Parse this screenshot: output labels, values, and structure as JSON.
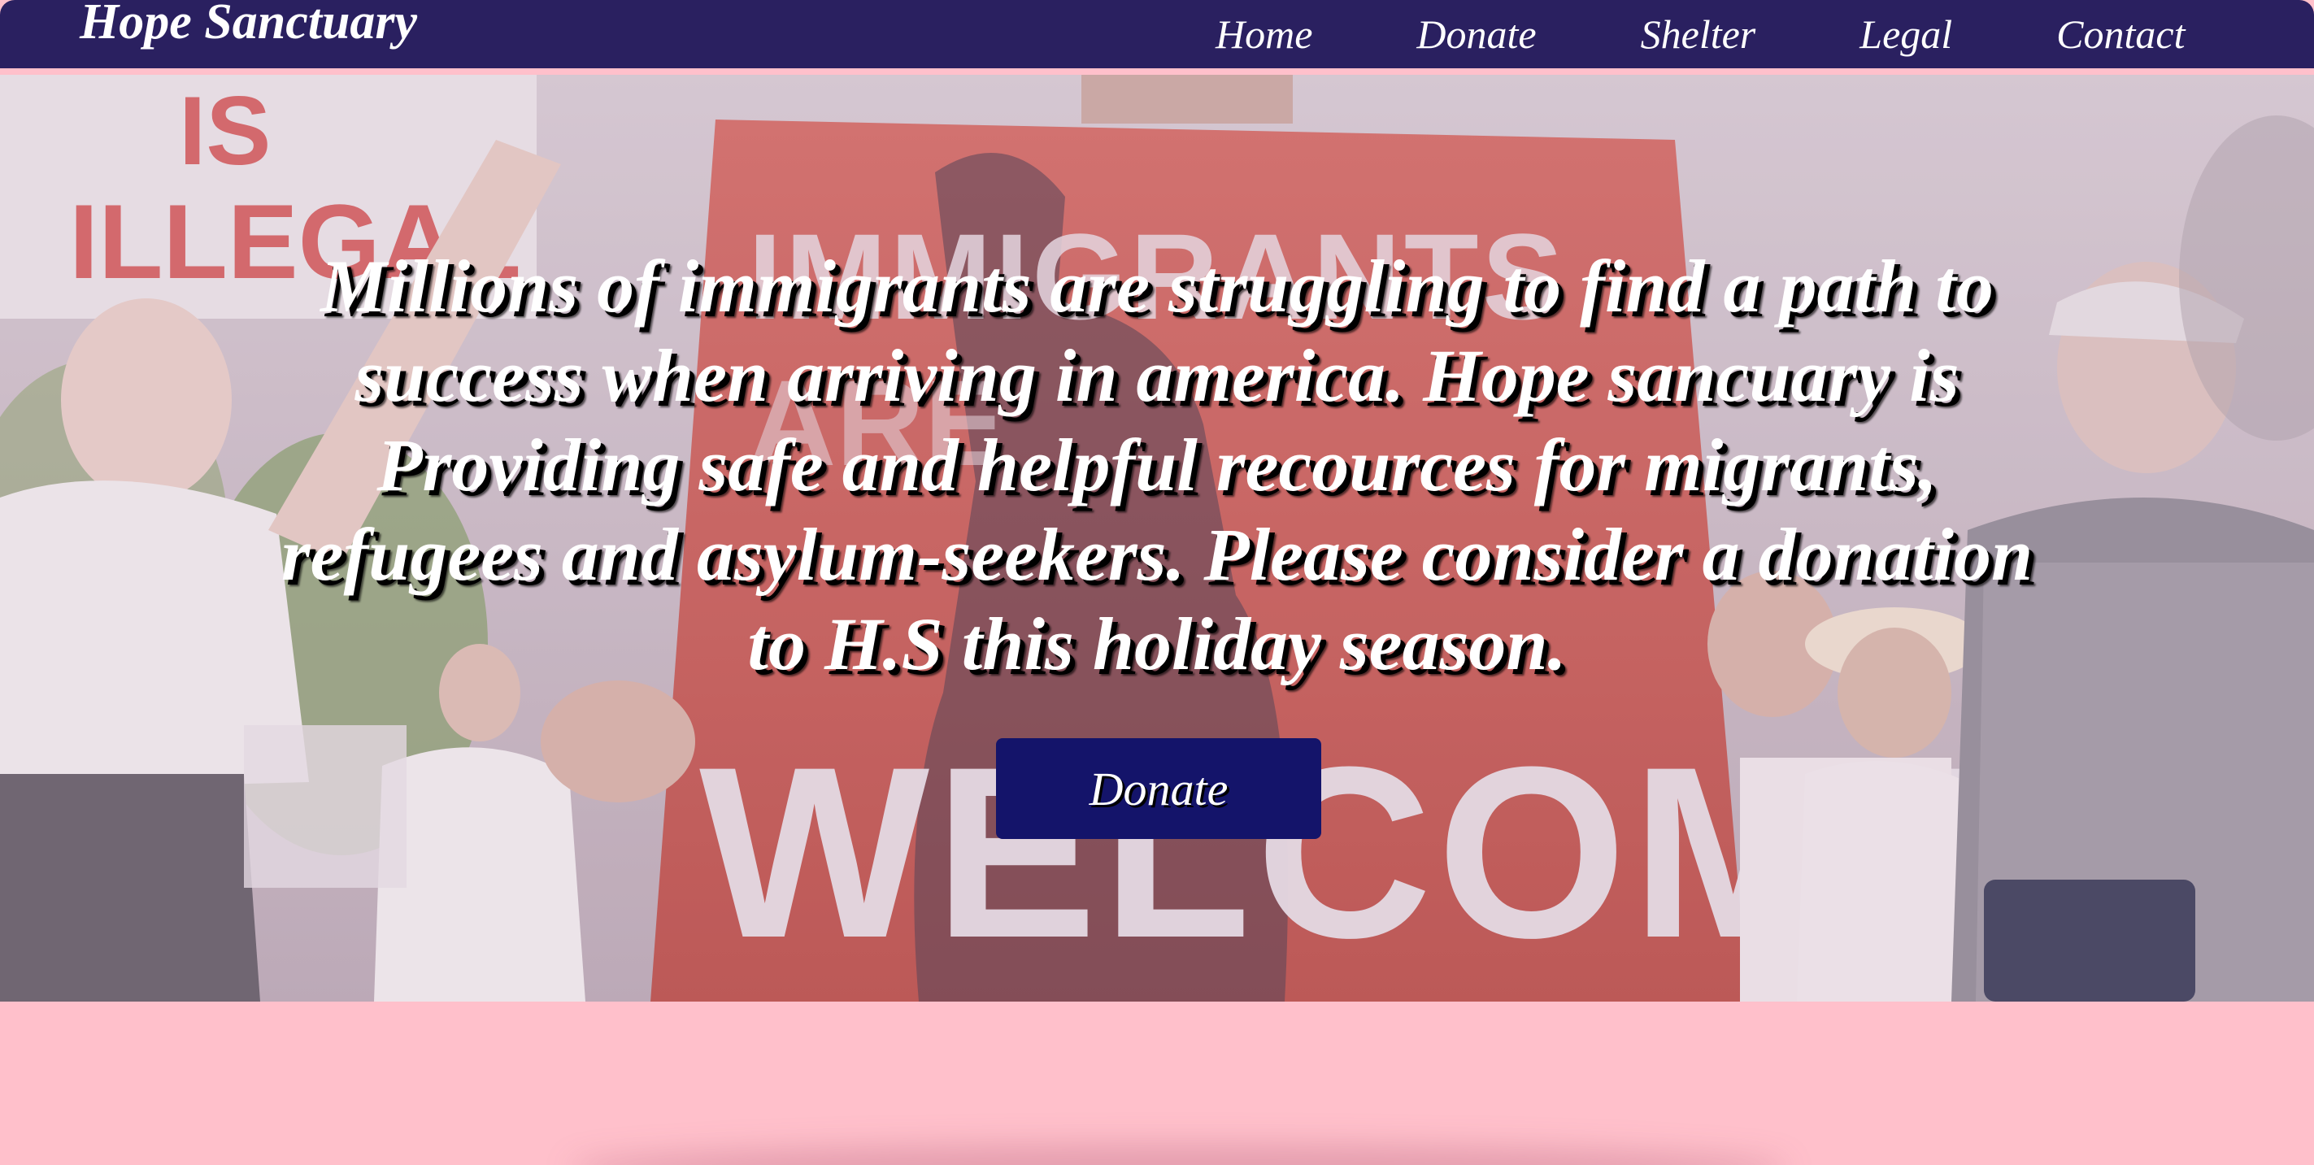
{
  "site": {
    "brand": "Hope Sanctuary"
  },
  "nav": {
    "items": [
      {
        "label": "Home"
      },
      {
        "label": "Donate"
      },
      {
        "label": "Shelter"
      },
      {
        "label": "Legal"
      },
      {
        "label": "Contact"
      }
    ]
  },
  "hero": {
    "message": "Millions of immigrants are struggling to find a path to success when arriving in america. Hope sancuary is Providing safe and helpful recources for migrants, refugees and asylum-seekers. Please consider a donation to H.S this holiday season.",
    "donate_label": "Donate",
    "photo_signs": {
      "left_sign": "IS ILLEGAL",
      "center_sign_top": "IMMIGRANTS",
      "center_sign_bottom": "WELCOME"
    }
  },
  "colors": {
    "navbar_bg": "#2a2060",
    "page_bg": "#ffc0cb",
    "button_bg": "#14146a",
    "sign_red": "#d85a55",
    "text": "#ffffff"
  },
  "icons": {
    "hero_photo": "protest-photo"
  }
}
